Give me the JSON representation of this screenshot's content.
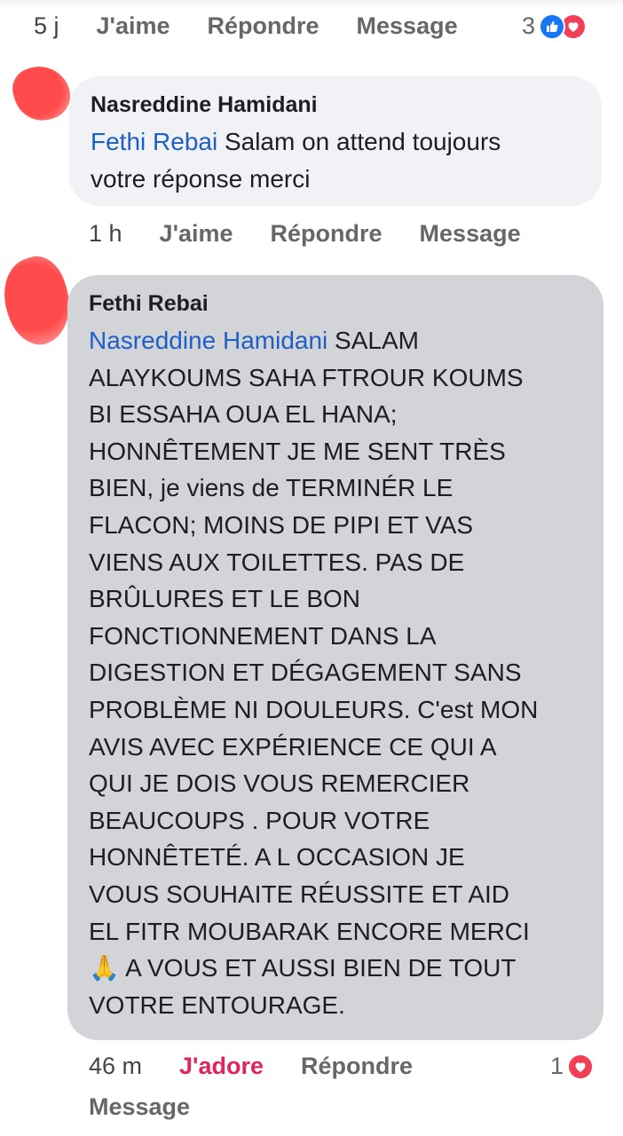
{
  "comment1_actions": {
    "time": "5 j",
    "like": "J'aime",
    "reply": "Répondre",
    "message": "Message",
    "reaction_count": "3"
  },
  "comment2": {
    "author": "Nasreddine Hamidani",
    "mention": "Fethi Rebai",
    "text": " Salam on attend toujours\nvotre réponse merci",
    "time": "1 h",
    "like": "J'aime",
    "reply": "Répondre",
    "message": "Message"
  },
  "comment3": {
    "author": "Fethi Rebai",
    "mention": "Nasreddine Hamidani",
    "text": " SALAM\nALAYKOUMS SAHA FTROUR KOUMS\nBI ESSAHA OUA EL HANA;\nHONNÊTEMENT JE ME SENT TRÈS\nBIEN, je viens de TERMINÉR LE\nFLACON;  MOINS DE PIPI ET VAS\nVIENS AUX TOILETTES. PAS DE\nBRÛLURES ET LE BON\nFONCTIONNEMENT DANS LA\nDIGESTION ET DÉGAGEMENT SANS\nPROBLÈME NI DOULEURS. C'est MON\nAVIS AVEC EXPÉRIENCE CE QUI A\nQUI JE DOIS VOUS REMERCIER\nBEAUCOUPS . POUR VOTRE\nHONNÊTETÉ. A L OCCASION JE\nVOUS SOUHAITE RÉUSSITE ET AID\nEL FITR MOUBARAK ENCORE MERCI\n🙏 A VOUS ET AUSSI BIEN DE TOUT\nVOTRE ENTOURAGE.",
    "time": "46 m",
    "adore": "J'adore",
    "reply": "Répondre",
    "message": "Message",
    "reaction_count": "1"
  },
  "colors": {
    "mention": "#1d5fc4",
    "like_blue": "#1877f2",
    "love_red": "#f33e58",
    "adore_red": "#e0245e"
  },
  "icons": [
    "like-reaction-icon",
    "love-reaction-icon"
  ]
}
